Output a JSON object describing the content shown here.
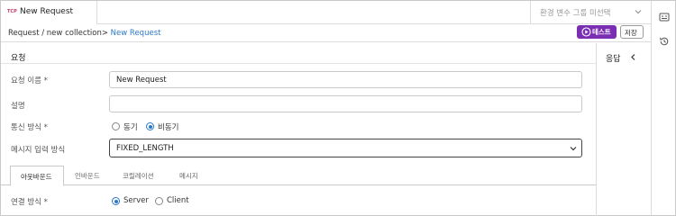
{
  "tab": {
    "method": "TCP",
    "title": "New Request"
  },
  "env": {
    "placeholder": "환경 변수 그룹 미선택"
  },
  "breadcrumb": {
    "path": "Request / new collection>",
    "current": " New Request"
  },
  "actions": {
    "test_label": "테스트",
    "save_label": "저장"
  },
  "response": {
    "label": "응답"
  },
  "request": {
    "section_title": "요청",
    "name_label": "요청 이름 *",
    "name_value": "New Request",
    "desc_label": "설명",
    "desc_value": "",
    "comm_label": "통신 방식 *",
    "comm_options": [
      "동기",
      "비동기"
    ],
    "comm_selected": "비동기",
    "msg_label": "메시지 입력 방식",
    "msg_value": "FIXED_LENGTH"
  },
  "subtabs": [
    "아웃바운드",
    "인바운드",
    "코릴레이션",
    "메시지"
  ],
  "subtab_active": "아웃바운드",
  "connection": {
    "label": "연결 방식 *",
    "options": [
      "Server",
      "Client"
    ],
    "selected": "Server"
  },
  "colors": {
    "accent": "#7a2fb3",
    "link": "#2b79c8"
  }
}
